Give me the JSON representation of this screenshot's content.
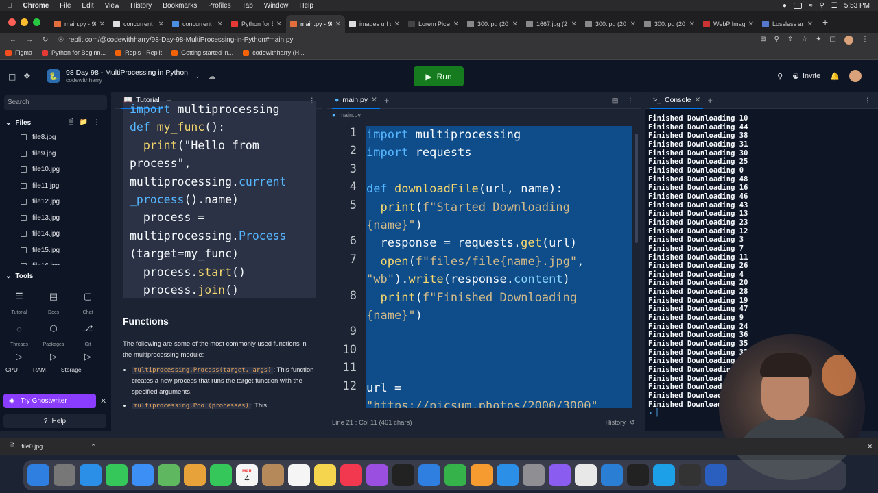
{
  "menubar": {
    "app": "Chrome",
    "items": [
      "File",
      "Edit",
      "View",
      "History",
      "Bookmarks",
      "Profiles",
      "Tab",
      "Window",
      "Help"
    ],
    "clock": "5:53 PM"
  },
  "tabs": [
    {
      "label": "main.py - 98",
      "color": "#e26d3d"
    },
    {
      "label": "concurrent",
      "color": "#dddddd"
    },
    {
      "label": "concurrent",
      "color": "#4a8fe0"
    },
    {
      "label": "Python for B",
      "color": "#e53935"
    },
    {
      "label": "main.py - 98",
      "color": "#e26d3d",
      "active": true
    },
    {
      "label": "images url c",
      "color": "#dddddd"
    },
    {
      "label": "Lorem Picsu",
      "color": "#444444"
    },
    {
      "label": "300.jpg (20",
      "color": "#888888"
    },
    {
      "label": "1667.jpg (2",
      "color": "#888888"
    },
    {
      "label": "300.jpg (20",
      "color": "#888888"
    },
    {
      "label": "300.jpg (20",
      "color": "#888888"
    },
    {
      "label": "WebP Imag",
      "color": "#cc3333"
    },
    {
      "label": "Lossless an",
      "color": "#5577cc"
    }
  ],
  "address": {
    "url": "replit.com/@codewithharry/98-Day-98-MultiProcessing-in-Python#main.py"
  },
  "bookmarks": [
    {
      "label": "Figma",
      "color": "#f24e1e"
    },
    {
      "label": "Python for Beginn...",
      "color": "#e53935"
    },
    {
      "label": "Repls - Replit",
      "color": "#f26207"
    },
    {
      "label": "Getting started in...",
      "color": "#f26207"
    },
    {
      "label": "codewithharry (H...",
      "color": "#f26207"
    }
  ],
  "replit": {
    "repl_title": "98 Day 98 - MultiProcessing in Python",
    "owner": "codewithharry",
    "run_label": "Run",
    "invite_label": "Invite"
  },
  "sidebar": {
    "search_placeholder": "Search",
    "files_label": "Files",
    "files": [
      "file8.jpg",
      "file9.jpg",
      "file10.jpg",
      "file11.jpg",
      "file12.jpg",
      "file13.jpg",
      "file14.jpg",
      "file15.jpg",
      "file16.jpg"
    ],
    "tools_label": "Tools",
    "tools": [
      {
        "label": "Tutorial",
        "icon": "book-icon"
      },
      {
        "label": "Docs",
        "icon": "docs-icon"
      },
      {
        "label": "Chat",
        "icon": "chat-icon"
      },
      {
        "label": "Threads",
        "icon": "threads-icon"
      },
      {
        "label": "Packages",
        "icon": "package-icon"
      },
      {
        "label": "Git",
        "icon": "git-icon"
      }
    ],
    "stats": [
      "CPU",
      "RAM",
      "Storage"
    ],
    "ghostwriter_label": "Try Ghostwriter",
    "help_label": "Help"
  },
  "tutorial": {
    "tab_label": "Tutorial",
    "code_lines": [
      "import multiprocessing",
      "def my_func():",
      "  print(\"Hello from",
      "process\",",
      "multiprocessing.current",
      "_process().name)",
      "  process =",
      "multiprocessing.Process",
      "(target=my_func)",
      "  process.start()",
      "  process.join()"
    ],
    "functions_title": "Functions",
    "functions_intro": "The following are some of the most commonly used functions in the multiprocessing module:",
    "items": [
      {
        "code": "multiprocessing.Process(target, args)",
        "text": ": This function creates a new process that runs the target function with the specified arguments."
      },
      {
        "code": "multiprocessing.Pool(processes)",
        "text": ": This"
      }
    ]
  },
  "editor": {
    "tab_label": "main.py",
    "breadcrumb": "main.py",
    "status_position": "Line 21 : Col 11 (461 chars)",
    "history_label": "History"
  },
  "console": {
    "tab_label": "Console",
    "lines": [
      "Finished Downloading 10",
      "Finished Downloading 44",
      "Finished Downloading 38",
      "Finished Downloading 31",
      "Finished Downloading 30",
      "Finished Downloading 25",
      "Finished Downloading 0",
      "Finished Downloading 48",
      "Finished Downloading 16",
      "Finished Downloading 46",
      "Finished Downloading 43",
      "Finished Downloading 13",
      "Finished Downloading 23",
      "Finished Downloading 12",
      "Finished Downloading 3",
      "Finished Downloading 7",
      "Finished Downloading 11",
      "Finished Downloading 26",
      "Finished Downloading 4",
      "Finished Downloading 20",
      "Finished Downloading 28",
      "Finished Downloading 19",
      "Finished Downloading 47",
      "Finished Downloading 9",
      "Finished Downloading 24",
      "Finished Downloading 36",
      "Finished Downloading 35",
      "Finished Downloading 33",
      "Finished Downloading",
      "Finished Downloading",
      "Finished Download",
      "Finished Download",
      "Finished Download",
      "Finished Download"
    ]
  },
  "download_bar": {
    "file": "file0.jpg"
  },
  "dock": {
    "apps": [
      {
        "name": "finder-icon",
        "color": "#2f7fe0"
      },
      {
        "name": "launchpad-icon",
        "color": "#777"
      },
      {
        "name": "safari-icon",
        "color": "#2b8fe8"
      },
      {
        "name": "messages-icon",
        "color": "#35c759"
      },
      {
        "name": "mail-icon",
        "color": "#3b8ff5"
      },
      {
        "name": "maps-icon",
        "color": "#5fb760"
      },
      {
        "name": "photos-icon",
        "color": "#e8a23a"
      },
      {
        "name": "facetime-icon",
        "color": "#35c759"
      },
      {
        "name": "calendar-icon",
        "color": "#f5f5f5"
      },
      {
        "name": "contacts-icon",
        "color": "#b5895a"
      },
      {
        "name": "reminders-icon",
        "color": "#f5f5f5"
      },
      {
        "name": "notes-icon",
        "color": "#f5d44e"
      },
      {
        "name": "music-icon",
        "color": "#f2384f"
      },
      {
        "name": "podcasts-icon",
        "color": "#9a4fe0"
      },
      {
        "name": "tv-icon",
        "color": "#222"
      },
      {
        "name": "keynote-icon",
        "color": "#2f7fe0"
      },
      {
        "name": "numbers-icon",
        "color": "#35b24a"
      },
      {
        "name": "pages-icon",
        "color": "#f59b2f"
      },
      {
        "name": "appstore-icon",
        "color": "#2b8fe8"
      },
      {
        "name": "settings-icon",
        "color": "#8e8e93"
      },
      {
        "name": "feedback-icon",
        "color": "#8a5cf0"
      },
      {
        "name": "chrome-icon",
        "color": "#e8e8e8"
      },
      {
        "name": "vscode-icon",
        "color": "#2a7fd4"
      },
      {
        "name": "terminal-icon",
        "color": "#222"
      },
      {
        "name": "skype-icon",
        "color": "#1ca0e8"
      },
      {
        "name": "obs-icon",
        "color": "#333"
      },
      {
        "name": "word-icon",
        "color": "#2b5fbf"
      }
    ],
    "calendar_month": "MAR",
    "calendar_day": "4"
  }
}
